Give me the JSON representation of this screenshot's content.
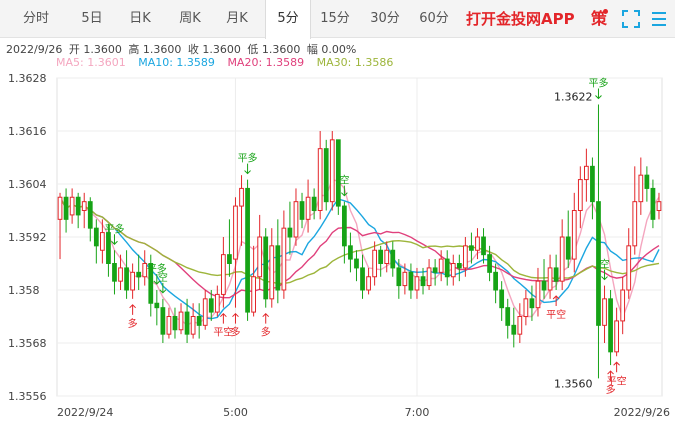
{
  "tabs": [
    {
      "label": "分时"
    },
    {
      "label": "5日"
    },
    {
      "label": "日K"
    },
    {
      "label": "周K"
    },
    {
      "label": "月K"
    },
    {
      "label": "5分"
    },
    {
      "label": "15分"
    },
    {
      "label": "30分"
    },
    {
      "label": "60分"
    }
  ],
  "active_tab": "5分",
  "promo_text": "打开金投网APP",
  "strategy_icon_text": "策",
  "icons": [
    "expand-icon",
    "menu-icon"
  ],
  "info": {
    "date": "2022/9/26",
    "open": "开 1.3600",
    "high": "高 1.3600",
    "close": "收 1.3600",
    "low": "低 1.3600",
    "change": "幅 0.00%"
  },
  "ma_legend": [
    {
      "label": "MA5: 1.3601",
      "color": "#f4a6bf"
    },
    {
      "label": "MA10: 1.3589",
      "color": "#1ba6e0"
    },
    {
      "label": "MA20: 1.3589",
      "color": "#e0407c"
    },
    {
      "label": "MA30: 1.3586",
      "color": "#9db53b"
    }
  ],
  "colors": {
    "up": "#e3262a",
    "down": "#16a316",
    "grid": "#ededed",
    "signal": "#e3262a",
    "signal_down": "#16a316"
  },
  "chart_data": {
    "type": "candlestick",
    "ylim": [
      1.3556,
      1.3628
    ],
    "y_ticks": [
      "1.3628",
      "1.3616",
      "1.3604",
      "1.3592",
      "1.358",
      "1.3568",
      "1.3556"
    ],
    "x_ticks": [
      {
        "label": "2022/9/24",
        "index": 0
      },
      {
        "label": "5:00",
        "index": 29
      },
      {
        "label": "7:00",
        "index": 59
      },
      {
        "label": "2022/9/26",
        "index": 99
      }
    ],
    "annotations": [
      {
        "text": "1.3622",
        "index": 89,
        "value": 1.3622,
        "type": "high"
      },
      {
        "text": "1.3560",
        "index": 89,
        "value": 1.356,
        "type": "low"
      }
    ],
    "signals": [
      {
        "text": "平多",
        "index": 9,
        "dir": "down"
      },
      {
        "text": "平多",
        "index": 31,
        "dir": "down"
      },
      {
        "text": "平多",
        "index": 89,
        "dir": "down"
      },
      {
        "text": "平多",
        "index": 16,
        "dir": "down"
      },
      {
        "text": "多",
        "index": 12,
        "dir": "up"
      },
      {
        "text": "多",
        "index": 29,
        "dir": "up"
      },
      {
        "text": "多",
        "index": 34,
        "dir": "up"
      },
      {
        "text": "多",
        "index": 91,
        "dir": "up"
      },
      {
        "text": "平空",
        "index": 27,
        "dir": "up"
      },
      {
        "text": "平空",
        "index": 82,
        "dir": "up"
      },
      {
        "text": "平空",
        "index": 92,
        "dir": "up"
      },
      {
        "text": "空",
        "index": 17,
        "dir": "down"
      },
      {
        "text": "空",
        "index": 47,
        "dir": "down"
      },
      {
        "text": "空",
        "index": 90,
        "dir": "down"
      }
    ],
    "candles": [
      [
        1.3596,
        1.3601,
        1.3587,
        1.3602
      ],
      [
        1.3601,
        1.3596,
        1.3593,
        1.3603
      ],
      [
        1.3597,
        1.3601,
        1.3595,
        1.3603
      ],
      [
        1.3601,
        1.3597,
        1.3594,
        1.3602
      ],
      [
        1.3598,
        1.36,
        1.3594,
        1.3602
      ],
      [
        1.36,
        1.3594,
        1.3591,
        1.3601
      ],
      [
        1.3594,
        1.359,
        1.3586,
        1.3596
      ],
      [
        1.3589,
        1.3593,
        1.3586,
        1.3596
      ],
      [
        1.3593,
        1.3586,
        1.3583,
        1.3595
      ],
      [
        1.3586,
        1.3582,
        1.3579,
        1.3589
      ],
      [
        1.3582,
        1.3585,
        1.358,
        1.3588
      ],
      [
        1.3585,
        1.358,
        1.3578,
        1.3589
      ],
      [
        1.358,
        1.3584,
        1.3578,
        1.3586
      ],
      [
        1.3584,
        1.3583,
        1.358,
        1.3588
      ],
      [
        1.3583,
        1.3586,
        1.3581,
        1.3589
      ],
      [
        1.3586,
        1.3577,
        1.3574,
        1.3588
      ],
      [
        1.3577,
        1.3576,
        1.3572,
        1.358
      ],
      [
        1.3576,
        1.357,
        1.3568,
        1.3578
      ],
      [
        1.357,
        1.3574,
        1.3569,
        1.3576
      ],
      [
        1.3574,
        1.3571,
        1.3569,
        1.3576
      ],
      [
        1.3571,
        1.3575,
        1.357,
        1.3577
      ],
      [
        1.3575,
        1.357,
        1.3568,
        1.3578
      ],
      [
        1.357,
        1.3574,
        1.3569,
        1.3577
      ],
      [
        1.3574,
        1.3572,
        1.3569,
        1.3577
      ],
      [
        1.3572,
        1.3578,
        1.3571,
        1.358
      ],
      [
        1.3578,
        1.3575,
        1.3573,
        1.358
      ],
      [
        1.3575,
        1.3579,
        1.3574,
        1.3581
      ],
      [
        1.3579,
        1.3588,
        1.3576,
        1.3592
      ],
      [
        1.3588,
        1.3586,
        1.3583,
        1.3596
      ],
      [
        1.3587,
        1.3599,
        1.3576,
        1.3601
      ],
      [
        1.3599,
        1.3603,
        1.359,
        1.3606
      ],
      [
        1.3603,
        1.3575,
        1.3573,
        1.3605
      ],
      [
        1.3575,
        1.3583,
        1.3574,
        1.359
      ],
      [
        1.3583,
        1.3592,
        1.358,
        1.3597
      ],
      [
        1.3592,
        1.3578,
        1.3576,
        1.3594
      ],
      [
        1.3578,
        1.359,
        1.3576,
        1.3594
      ],
      [
        1.359,
        1.358,
        1.3577,
        1.3596
      ],
      [
        1.358,
        1.3594,
        1.3578,
        1.3598
      ],
      [
        1.3594,
        1.3592,
        1.3588,
        1.36
      ],
      [
        1.3592,
        1.36,
        1.359,
        1.3603
      ],
      [
        1.36,
        1.3596,
        1.3594,
        1.3602
      ],
      [
        1.3596,
        1.3601,
        1.3593,
        1.3605
      ],
      [
        1.3601,
        1.3598,
        1.3596,
        1.3603
      ],
      [
        1.3598,
        1.3612,
        1.3596,
        1.3616
      ],
      [
        1.3612,
        1.36,
        1.3598,
        1.3614
      ],
      [
        1.36,
        1.3614,
        1.3598,
        1.3616
      ],
      [
        1.3614,
        1.3599,
        1.3597,
        1.3614
      ],
      [
        1.3599,
        1.359,
        1.3586,
        1.36
      ],
      [
        1.359,
        1.3587,
        1.3584,
        1.3593
      ],
      [
        1.3587,
        1.3585,
        1.3582,
        1.3589
      ],
      [
        1.3585,
        1.358,
        1.3578,
        1.3588
      ],
      [
        1.358,
        1.3583,
        1.3579,
        1.3585
      ],
      [
        1.3583,
        1.3589,
        1.3581,
        1.3591
      ],
      [
        1.3589,
        1.3586,
        1.3583,
        1.359
      ],
      [
        1.3586,
        1.3589,
        1.3584,
        1.3591
      ],
      [
        1.3589,
        1.3585,
        1.3583,
        1.3591
      ],
      [
        1.3585,
        1.3581,
        1.3578,
        1.3587
      ],
      [
        1.3581,
        1.3584,
        1.3579,
        1.3586
      ],
      [
        1.3584,
        1.358,
        1.3578,
        1.3586
      ],
      [
        1.358,
        1.3583,
        1.3578,
        1.3585
      ],
      [
        1.3583,
        1.3581,
        1.3579,
        1.3585
      ],
      [
        1.3581,
        1.3585,
        1.358,
        1.3587
      ],
      [
        1.3585,
        1.3584,
        1.3581,
        1.3587
      ],
      [
        1.3584,
        1.3587,
        1.3582,
        1.3589
      ],
      [
        1.3587,
        1.3583,
        1.3581,
        1.3589
      ],
      [
        1.3583,
        1.3586,
        1.3581,
        1.3588
      ],
      [
        1.3586,
        1.3585,
        1.3582,
        1.3588
      ],
      [
        1.3585,
        1.359,
        1.3583,
        1.3592
      ],
      [
        1.359,
        1.3589,
        1.3586,
        1.3593
      ],
      [
        1.3589,
        1.3592,
        1.3587,
        1.3594
      ],
      [
        1.3592,
        1.3588,
        1.3586,
        1.3594
      ],
      [
        1.3588,
        1.3584,
        1.3582,
        1.359
      ],
      [
        1.3584,
        1.358,
        1.3577,
        1.3586
      ],
      [
        1.358,
        1.3576,
        1.3573,
        1.3582
      ],
      [
        1.3576,
        1.3572,
        1.3569,
        1.3578
      ],
      [
        1.3572,
        1.357,
        1.3567,
        1.3576
      ],
      [
        1.357,
        1.3574,
        1.3568,
        1.3577
      ],
      [
        1.3574,
        1.3578,
        1.3572,
        1.358
      ],
      [
        1.3578,
        1.3576,
        1.3573,
        1.3581
      ],
      [
        1.3576,
        1.3582,
        1.3574,
        1.3585
      ],
      [
        1.3582,
        1.358,
        1.3578,
        1.3587
      ],
      [
        1.358,
        1.3585,
        1.3578,
        1.3588
      ],
      [
        1.3585,
        1.3582,
        1.358,
        1.3588
      ],
      [
        1.3582,
        1.3592,
        1.358,
        1.3596
      ],
      [
        1.3592,
        1.3587,
        1.3585,
        1.3598
      ],
      [
        1.3587,
        1.3598,
        1.3584,
        1.3602
      ],
      [
        1.3598,
        1.3605,
        1.3594,
        1.3608
      ],
      [
        1.3605,
        1.3608,
        1.36,
        1.3612
      ],
      [
        1.3608,
        1.36,
        1.3596,
        1.361
      ],
      [
        1.36,
        1.3572,
        1.356,
        1.3622
      ],
      [
        1.3572,
        1.3578,
        1.3568,
        1.3581
      ],
      [
        1.3578,
        1.3566,
        1.3563,
        1.358
      ],
      [
        1.3566,
        1.3573,
        1.3565,
        1.3576
      ],
      [
        1.3573,
        1.358,
        1.357,
        1.3583
      ],
      [
        1.358,
        1.359,
        1.3578,
        1.3594
      ],
      [
        1.359,
        1.36,
        1.3588,
        1.3608
      ],
      [
        1.36,
        1.3606,
        1.3597,
        1.361
      ],
      [
        1.3606,
        1.3603,
        1.36,
        1.3608
      ],
      [
        1.3603,
        1.3596,
        1.3594,
        1.3605
      ],
      [
        1.3598,
        1.36,
        1.3596,
        1.3602
      ]
    ]
  }
}
